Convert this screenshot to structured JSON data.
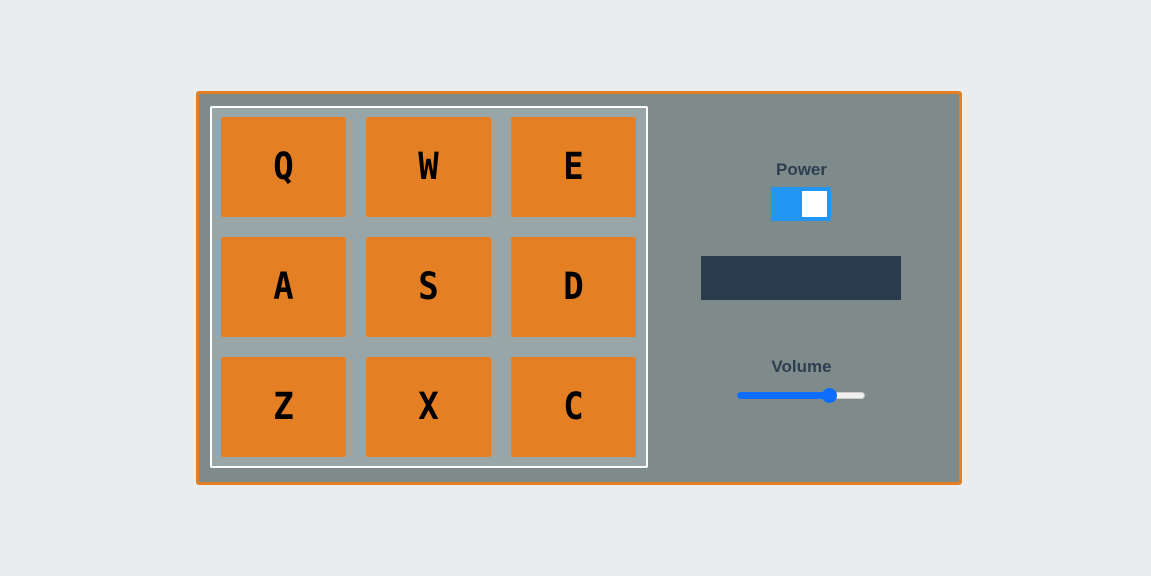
{
  "drum_machine": {
    "pads": [
      {
        "key": "Q"
      },
      {
        "key": "W"
      },
      {
        "key": "E"
      },
      {
        "key": "A"
      },
      {
        "key": "S"
      },
      {
        "key": "D"
      },
      {
        "key": "Z"
      },
      {
        "key": "X"
      },
      {
        "key": "C"
      }
    ],
    "controls": {
      "power_label": "Power",
      "power_on": true,
      "display_text": "",
      "volume_label": "Volume",
      "volume_value": 0.72
    },
    "colors": {
      "accent": "#e57f23",
      "panel": "#7f8b8b",
      "pad_bank": "#98a6a7",
      "display": "#2b3b4e",
      "toggle_on": "#2196f3",
      "slider": "#0d6efd"
    }
  }
}
